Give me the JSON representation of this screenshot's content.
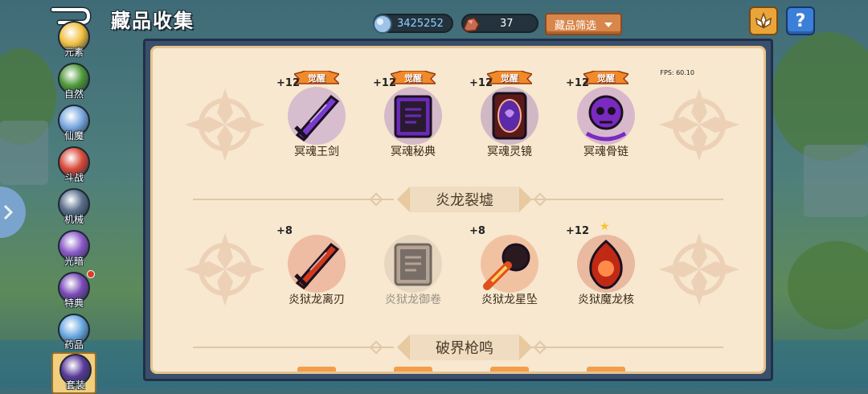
{
  "header": {
    "title": "藏品收集",
    "gems": "3425252",
    "stones": "37",
    "filter_label": "藏品筛选"
  },
  "sidebar": {
    "items": [
      {
        "label": "元素",
        "icon": "element-icon",
        "color": "#f0c040"
      },
      {
        "label": "自然",
        "icon": "nature-icon",
        "color": "#4f9a3a"
      },
      {
        "label": "仙魔",
        "icon": "fairy-demon-icon",
        "color": "#7aa8e0"
      },
      {
        "label": "斗战",
        "icon": "battle-icon",
        "color": "#d94a3a"
      },
      {
        "label": "机械",
        "icon": "mech-icon",
        "color": "#5a6f8a"
      },
      {
        "label": "光暗",
        "icon": "light-dark-icon",
        "color": "#8a5ac8"
      },
      {
        "label": "特典",
        "icon": "special-icon",
        "color": "#7a4ab8"
      },
      {
        "label": "药品",
        "icon": "potion-icon",
        "color": "#6aa8e0"
      },
      {
        "label": "套装",
        "icon": "set-icon",
        "color": "#5a3a9a"
      }
    ]
  },
  "fps": "FPS: 60.10",
  "sections": [
    {
      "items": [
        {
          "name": "冥魂王剑",
          "level": "+12",
          "awaken": "觉醒",
          "icon": "sword-icon",
          "color": "#7a3ad0"
        },
        {
          "name": "冥魂秘典",
          "level": "+12",
          "awaken": "觉醒",
          "icon": "tome-icon",
          "color": "#6a2ab8"
        },
        {
          "name": "冥魂灵镜",
          "level": "+12",
          "awaken": "觉醒",
          "icon": "mirror-icon",
          "color": "#5a2aa8"
        },
        {
          "name": "冥魂骨链",
          "level": "+12",
          "awaken": "觉醒",
          "icon": "bone-chain-icon",
          "color": "#7a2ac0"
        }
      ]
    },
    {
      "title": "炎龙裂墟",
      "items": [
        {
          "name": "炎狱龙离刃",
          "level": "+8",
          "icon": "blade-icon",
          "color": "#d0391c"
        },
        {
          "name": "炎狱龙御卷",
          "level": "",
          "icon": "scroll-icon",
          "color": "#b86a4a",
          "locked": true
        },
        {
          "name": "炎狱龙星坠",
          "level": "+8",
          "icon": "meteor-icon",
          "color": "#e0501c"
        },
        {
          "name": "炎狱魔龙核",
          "level": "+12",
          "icon": "dragon-core-icon",
          "color": "#c02a14",
          "star": true
        }
      ]
    },
    {
      "title": "破界枪鸣"
    }
  ]
}
